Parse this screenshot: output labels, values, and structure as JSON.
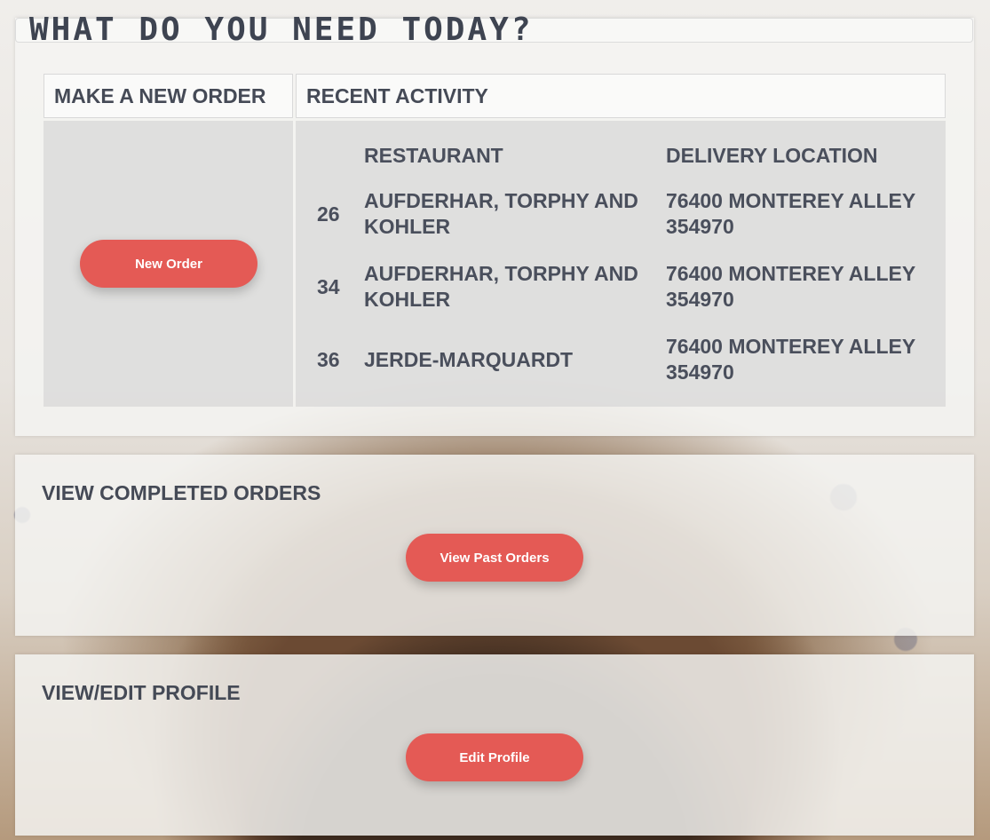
{
  "page_title": "WHAT DO YOU NEED TODAY?",
  "new_order": {
    "heading": "MAKE A NEW ORDER",
    "button_label": "New Order"
  },
  "recent_activity": {
    "heading": "RECENT ACTIVITY",
    "columns": [
      "",
      "RESTAURANT",
      "DELIVERY LOCATION"
    ],
    "rows": [
      {
        "id": "26",
        "restaurant": "AUFDERHAR, TORPHY AND KOHLER",
        "location": "76400 MONTEREY ALLEY 354970"
      },
      {
        "id": "34",
        "restaurant": "AUFDERHAR, TORPHY AND KOHLER",
        "location": "76400 MONTEREY ALLEY 354970"
      },
      {
        "id": "36",
        "restaurant": "JERDE-MARQUARDT",
        "location": "76400 MONTEREY ALLEY 354970"
      }
    ]
  },
  "completed_orders": {
    "heading": "VIEW COMPLETED ORDERS",
    "button_label": "View Past Orders"
  },
  "profile": {
    "heading": "VIEW/EDIT PROFILE",
    "button_label": "Edit Profile"
  },
  "colors": {
    "accent": "#e45a55",
    "heading_text": "#454a56"
  }
}
